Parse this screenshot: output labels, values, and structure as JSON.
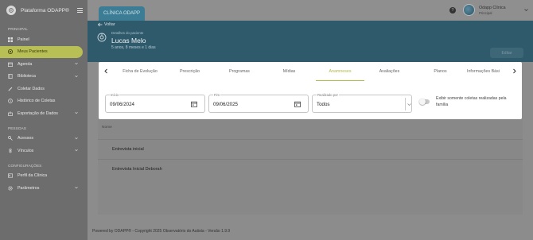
{
  "app": {
    "brand": "Plataforma ODAPP®",
    "clinic_tab": "CLÍNICA ODAPP"
  },
  "user": {
    "name": "Odapp Clínica",
    "role": "Principal"
  },
  "sidebar": {
    "sections": {
      "principal": "PRINCIPAL",
      "pessoas": "PESSOAS",
      "configuracoes": "CONFIGURAÇÕES"
    },
    "items": [
      {
        "label": "Painel",
        "icon": "dashboard-icon"
      },
      {
        "label": "Meus Pacientes",
        "icon": "patients-icon",
        "active": true
      },
      {
        "label": "Agenda",
        "icon": "calendar-icon"
      },
      {
        "label": "Biblioteca",
        "icon": "book-icon"
      },
      {
        "label": "Coletar Dados",
        "icon": "pencil-icon"
      },
      {
        "label": "Histórico de Coletas",
        "icon": "history-icon"
      },
      {
        "label": "Exportação de Dados",
        "icon": "export-icon"
      },
      {
        "label": "Acessos",
        "icon": "key-icon"
      },
      {
        "label": "Vínculos",
        "icon": "link-icon"
      },
      {
        "label": "Perfil da Clínica",
        "icon": "profile-icon"
      },
      {
        "label": "Parâmetros",
        "icon": "gear-icon"
      }
    ]
  },
  "patient": {
    "back_label": "Voltar",
    "details_label": "Detalhes do paciente",
    "name": "Lucas Melo",
    "age": "5 anos, 8 meses e 1 dias",
    "edit_button": "Editar"
  },
  "tabs": [
    {
      "label": "Ficha de Evolução"
    },
    {
      "label": "Prescrição"
    },
    {
      "label": "Programas"
    },
    {
      "label": "Mídias"
    },
    {
      "label": "Anamneses",
      "active": true
    },
    {
      "label": "Avaliações"
    },
    {
      "label": "Planos"
    },
    {
      "label": "Informações Bási"
    }
  ],
  "filters": {
    "start": {
      "label": "Início",
      "value": "09/06/2024"
    },
    "end": {
      "label": "Fim",
      "value": "09/06/2025"
    },
    "performed_by": {
      "label": "Realizado por",
      "value": "Todos"
    },
    "family_toggle_label": "Exibir somente coletas realizadas pela família",
    "family_toggle_on": false
  },
  "table": {
    "column": "Nome",
    "rows": [
      "Entrevista inicial",
      "Entrevista Inicial Deborah"
    ]
  },
  "footer": "Powered by ODAPP® - Copyright 2025 Observatório do Autista - Versão 1.9.9"
}
